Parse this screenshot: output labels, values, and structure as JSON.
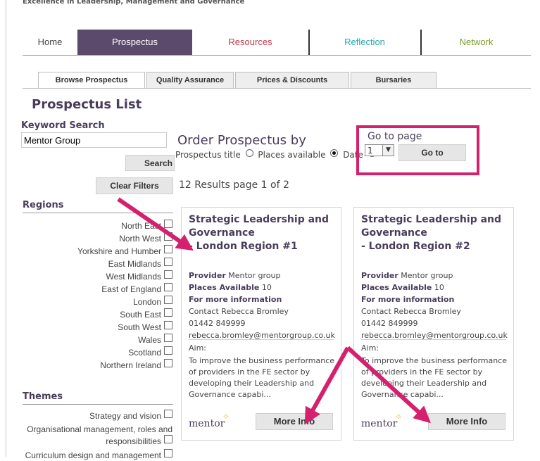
{
  "tagline": "Excellence in Leadership, Management and Governance",
  "main_nav": {
    "home": "Home",
    "prospectus": "Prospectus",
    "resources": "Resources",
    "reflection": "Reflection",
    "network": "Network"
  },
  "sub_tabs": [
    "Browse Prospectus",
    "Quality Assurance",
    "Prices & Discounts",
    "Bursaries"
  ],
  "page_title": "Prospectus List",
  "keyword_search": {
    "label": "Keyword Search",
    "value": "Mentor Group",
    "search_button": "Search",
    "clear_button": "Clear Filters"
  },
  "order": {
    "title": "Order Prospectus by",
    "options": [
      "Prospectus title",
      "Places available",
      "Date"
    ],
    "selected": "Places available"
  },
  "go_to": {
    "label": "Go to page",
    "page_value": "1",
    "button": "Go to"
  },
  "results_text": "12 Results page 1 of 2",
  "regions": {
    "title": "Regions",
    "items": [
      "North East",
      "North West",
      "Yorkshire and Humber",
      "East Midlands",
      "West Midlands",
      "East of England",
      "London",
      "South East",
      "South West",
      "Wales",
      "Scotland",
      "Northern Ireland"
    ]
  },
  "themes": {
    "title": "Themes",
    "items": [
      "Strategy and vision",
      "Organisational management, roles and",
      "responsibilities",
      "Curriculum design and management"
    ]
  },
  "cards": [
    {
      "title_1": "Strategic Leadership and",
      "title_2": "Governance",
      "title_3": "- London Region #1",
      "provider_label": "Provider",
      "provider": "Mentor group",
      "places_label": "Places Available",
      "places": "10",
      "more_info_heading": "For more information",
      "contact": "Contact Rebecca Bromley",
      "phone": "01442 849999",
      "email": "rebecca.bromley@mentorgroup.co.uk",
      "aim_label": "Aim:",
      "aim_text": "To improve the business performance of providers in the FE sector by developing their Leadership and Governance capabi...",
      "logo": "mentor",
      "button": "More Info"
    },
    {
      "title_1": "Strategic Leadership and",
      "title_2": "Governance",
      "title_3": "- London Region #2",
      "provider_label": "Provider",
      "provider": "Mentor group",
      "places_label": "Places Available",
      "places": "10",
      "more_info_heading": "For more information",
      "contact": "Contact Rebecca Bromley",
      "phone": "01442 849999",
      "email": "rebecca.bromley@mentorgroup.co.uk",
      "aim_label": "Aim:",
      "aim_text": "To improve the business performance of providers in the FE sector by developing their Leadership and Governance capabi...",
      "logo": "mentor",
      "button": "More Info"
    }
  ],
  "colors": {
    "accent_purple": "#5b4a6b",
    "annotation_pink": "#d4206d",
    "resources_red": "#c23a4a",
    "reflection_teal": "#2aa6b3",
    "network_green": "#7a9a2b"
  }
}
